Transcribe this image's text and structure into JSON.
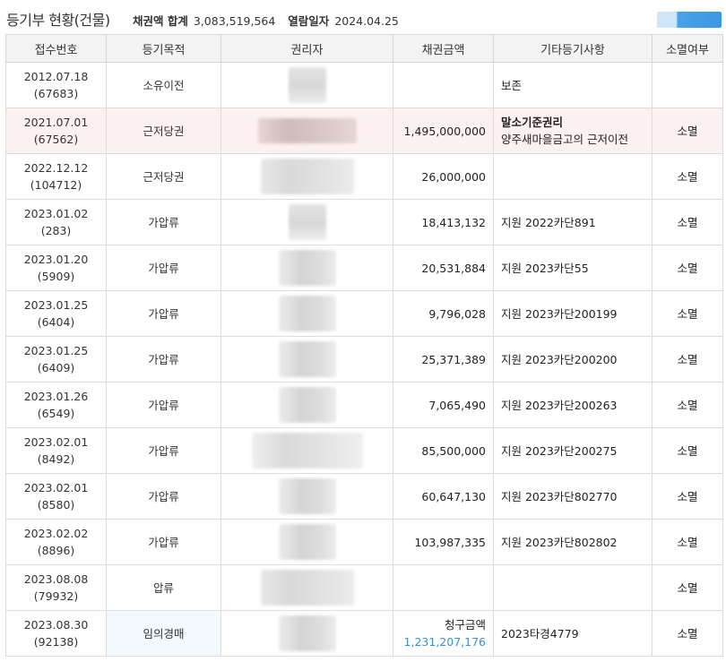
{
  "header": {
    "title": "등기부 현황(건물)",
    "sum_label": "채권액 합계",
    "sum_value": "3,083,519,564",
    "date_label": "열람일자",
    "date_value": "2024.04.25"
  },
  "columns": [
    "접수번호",
    "등기목적",
    "권리자",
    "채권금액",
    "기타등기사항",
    "소멸여부"
  ],
  "rows": [
    {
      "date": "2012.07.18",
      "num": "(67683)",
      "purpose": "소유이전",
      "amount": "",
      "etc": "보존",
      "etc_sub": "",
      "status": ""
    },
    {
      "date": "2021.07.01",
      "num": "(67562)",
      "purpose": "근저당권",
      "amount": "1,495,000,000",
      "etc": "말소기준권리",
      "etc_sub": "양주새마을금고의 근저이전",
      "status": "소멸"
    },
    {
      "date": "2022.12.12",
      "num": "(104712)",
      "purpose": "근저당권",
      "amount": "26,000,000",
      "etc": "",
      "etc_sub": "",
      "status": "소멸"
    },
    {
      "date": "2023.01.02",
      "num": "(283)",
      "purpose": "가압류",
      "amount": "18,413,132",
      "etc": "지원 2022카단891",
      "etc_sub": "",
      "status": "소멸"
    },
    {
      "date": "2023.01.20",
      "num": "(5909)",
      "purpose": "가압류",
      "amount": "20,531,884",
      "etc": "지원 2023카단55",
      "etc_sub": "",
      "status": "소멸"
    },
    {
      "date": "2023.01.25",
      "num": "(6404)",
      "purpose": "가압류",
      "amount": "9,796,028",
      "etc": "지원 2023카단200199",
      "etc_sub": "",
      "status": "소멸"
    },
    {
      "date": "2023.01.25",
      "num": "(6409)",
      "purpose": "가압류",
      "amount": "25,371,389",
      "etc": "지원 2023카단200200",
      "etc_sub": "",
      "status": "소멸"
    },
    {
      "date": "2023.01.26",
      "num": "(6549)",
      "purpose": "가압류",
      "amount": "7,065,490",
      "etc": "지원 2023카단200263",
      "etc_sub": "",
      "status": "소멸"
    },
    {
      "date": "2023.02.01",
      "num": "(8492)",
      "purpose": "가압류",
      "amount": "85,500,000",
      "etc": "지원 2023카단200275",
      "etc_sub": "",
      "status": "소멸"
    },
    {
      "date": "2023.02.01",
      "num": "(8580)",
      "purpose": "가압류",
      "amount": "60,647,130",
      "etc": "지원 2023카단802770",
      "etc_sub": "",
      "status": "소멸"
    },
    {
      "date": "2023.02.02",
      "num": "(8896)",
      "purpose": "가압류",
      "amount": "103,987,335",
      "etc": "지원 2023카단802802",
      "etc_sub": "",
      "status": "소멸"
    },
    {
      "date": "2023.08.08",
      "num": "(79932)",
      "purpose": "압류",
      "amount": "",
      "etc": "",
      "etc_sub": "",
      "status": "소멸"
    },
    {
      "date": "2023.08.30",
      "num": "(92138)",
      "purpose": "임의경매",
      "amount_label": "청구금액",
      "amount": "1,231,207,176",
      "etc": "2023타경4779",
      "etc_sub": "",
      "status": "소멸"
    }
  ],
  "colors": {
    "highlight_row": "#fdf0f0",
    "auction_cell": "#f3f9fe",
    "claim_amount": "#3a8fd9",
    "header_bg": "#f3f3f3"
  }
}
